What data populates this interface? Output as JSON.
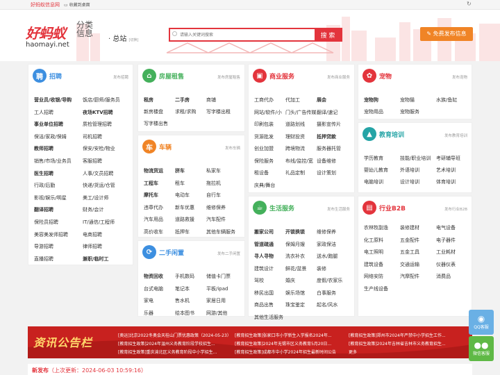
{
  "topbar": {
    "site": "好蚂蚁信息网",
    "fav": "收藏到桌面"
  },
  "header": {
    "logo_cn": "好蚂蚁",
    "logo_en": "haomayi.net",
    "slogan": "分类信息",
    "station": "总站",
    "station_switch": "[切换]",
    "search_placeholder": "请输入关键词搜索",
    "search_button": "搜 索",
    "post_button": "免费发布信息"
  },
  "panels": [
    {
      "id": "zhaopin",
      "icon": "聘",
      "color": "#3d8fe0",
      "title": "招聘",
      "more": "发布招聘",
      "rows": [
        [
          "营业员/收银/导购",
          "饭店/厨师/服务员"
        ],
        [
          "工人招聘",
          "夜场KTV招聘"
        ],
        [
          "事业单位招聘",
          "质检管理招聘"
        ],
        [
          "保洁/家政/保姆",
          "司机招聘"
        ],
        [
          "教师招聘",
          "保安/安检/物业"
        ],
        [
          "销售/市场/业务员",
          "客服招聘"
        ],
        [
          "医生招聘",
          "人事/文员招聘"
        ],
        [
          "行政/后勤",
          "快递/货运/仓管"
        ],
        [
          "影视/娱乐/明星",
          "美工/设计师"
        ],
        [
          "翻译招聘",
          "财务/会计"
        ],
        [
          "保险员招聘",
          "IT/通信/工程师"
        ],
        [
          "美容美发师招聘",
          "电商招聘"
        ],
        [
          "导游招聘",
          "律师招聘"
        ],
        [
          "直播招聘",
          "兼职/临时工"
        ]
      ],
      "bold": [
        "营业员/收银/导购",
        "夜场KTV招聘",
        "事业单位招聘",
        "教师招聘",
        "医生招聘",
        "翻译招聘",
        "兼职/临时工"
      ]
    },
    {
      "id": "fang",
      "icon": "⌂",
      "color": "#44b05b",
      "title": "房屋租售",
      "more": "发布房屋租售",
      "rows": [
        [
          "租房",
          "二手房",
          "商铺"
        ],
        [
          "新房楼盘",
          "求租/求购",
          "写字楼出租"
        ],
        [
          "写字楼出售"
        ]
      ],
      "bold": [
        "租房",
        "二手房"
      ]
    },
    {
      "id": "che",
      "icon": "车",
      "color": "#f08426",
      "title": "车辆",
      "more": "发布车辆",
      "rows": [
        [
          "物流货运",
          "拼车",
          "私家车"
        ],
        [
          "工程车",
          "租车",
          "拖拉机"
        ],
        [
          "摩托车",
          "电动车",
          "自行车"
        ],
        [
          "违章代办",
          "新车优惠",
          "维修保养"
        ],
        [
          "汽车用品",
          "道路救援",
          "汽车配件"
        ],
        [
          "高价收车",
          "抵押车",
          "其他车辆服务"
        ]
      ],
      "bold": [
        "物流货运",
        "拼车",
        "工程车",
        "摩托车"
      ]
    },
    {
      "id": "ershou",
      "icon": "⟳",
      "color": "#3d8fe0",
      "title": "二手闲置",
      "more": "发布二手闲置",
      "rows": [
        [
          "物资回收",
          "手机数码",
          "储值卡门票"
        ],
        [
          "台式电脑",
          "笔记本",
          "平板/ipad"
        ],
        [
          "家电",
          "售水机",
          "家居日用"
        ],
        [
          "乐器",
          "绘本图书",
          "网游/其他"
        ]
      ],
      "bold": [
        "物资回收"
      ]
    },
    {
      "id": "shangwu",
      "icon": "▣",
      "color": "#e3343c",
      "title": "商业服务",
      "more": "发布商业服务",
      "rows": [
        [
          "工商代办",
          "代加工",
          "展会"
        ],
        [
          "网站/软件/小",
          "门头/广告传媒",
          "翻译/速记"
        ],
        [
          "印刷包装",
          "道路划线",
          "摄影宣传片"
        ],
        [
          "货源批发",
          "理财投资",
          "抵押贷款"
        ],
        [
          "创业加盟",
          "跨境物流",
          "服务器托管"
        ],
        [
          "保险服务",
          "布线/监控/宽",
          "设备维修"
        ],
        [
          "租设备",
          "礼品定制",
          "设计策划"
        ],
        [
          "庆典/舞台"
        ]
      ],
      "bold": [
        "展会",
        "抵押贷款"
      ]
    },
    {
      "id": "shenghuo",
      "icon": "☕",
      "color": "#44b05b",
      "title": "生活服务",
      "more": "发布生活服务",
      "rows": [
        [
          "搬家公司",
          "开锁换锁",
          "维修保养"
        ],
        [
          "管道疏通",
          "保姆月嫂",
          "家政保洁"
        ],
        [
          "寻人寻物",
          "洗衣补衣",
          "送水/跑腿"
        ],
        [
          "建筑设计",
          "鲜花/盆景",
          "装修"
        ],
        [
          "驾校",
          "婚庆",
          "度假/农家乐"
        ],
        [
          "移民出国",
          "娱乐场馆",
          "白事服务"
        ],
        [
          "商品出售",
          "珠宝鉴定",
          "起名/风水"
        ],
        [
          "其他生活服务"
        ]
      ],
      "bold": [
        "搬家公司",
        "开锁换锁",
        "管道疏通",
        "寻人寻物"
      ]
    },
    {
      "id": "chongwu",
      "icon": "✿",
      "color": "#e3343c",
      "title": "宠物",
      "more": "发布宠物",
      "rows": [
        [
          "宠物狗",
          "宠物猫",
          "水族/鱼缸"
        ],
        [
          "宠物用品",
          "宠物服务"
        ]
      ],
      "bold": [
        "宠物狗"
      ]
    },
    {
      "id": "jiaoyu",
      "icon": "▲",
      "color": "#25a4a6",
      "title": "教育培训",
      "more": "发布教育培训",
      "rows": [
        [
          "学历教育",
          "技能/职业培训",
          "考研辅导班"
        ],
        [
          "婴幼儿教育",
          "外语培训",
          "艺术培训"
        ],
        [
          "电脑培训",
          "设计培训",
          "体育培训"
        ]
      ],
      "bold": []
    },
    {
      "id": "b2b",
      "icon": "▤",
      "color": "#e3343c",
      "title": "行业B2B",
      "more": "发布行业B2B",
      "rows": [
        [
          "农林牧副渔",
          "装修建材",
          "电气设备"
        ],
        [
          "化工原料",
          "五金配件",
          "电子器件"
        ],
        [
          "电工照明",
          "五金工具",
          "工业耗材"
        ],
        [
          "建筑设备",
          "交通运输",
          "仪器仪表"
        ],
        [
          "网络安防",
          "汽摩配件",
          "消费品"
        ],
        [
          "生产线设备"
        ]
      ],
      "bold": []
    }
  ],
  "news": {
    "label": "资讯公告栏",
    "items": [
      [
        "[奥运]北京2022冬奥会天桂山门票优惠政策（2024-05-23）",
        "[教育招生政策]张家口市小学新生入学报名2024年...",
        "[教育招生政策]郑州市2024年严禁中小学招生工作..."
      ],
      [
        "[教育招生政策]2024年温州义务教育阶段学校招生...",
        "[教育招生政策]2024年无锡市区义务教育5月20日...",
        "[教育招生政策]2024年吉林省吉林市义务教育招生..."
      ],
      [
        "[教育招生政策]重庆渝北区义务教育阶段中小学招生...",
        "[教育招生政策]成都市中小学2024年招生最新时间公告",
        "更多"
      ]
    ]
  },
  "latest": {
    "label": "新发布",
    "updated": "（上次更新：2024-06-03 10:59:16）"
  },
  "float": {
    "qq": "QQ客服",
    "wechat": "微信客服"
  },
  "colors": {
    "brand": "#e3343c",
    "orange": "#f08426",
    "green": "#44b05b",
    "blue": "#3d8fe0"
  }
}
